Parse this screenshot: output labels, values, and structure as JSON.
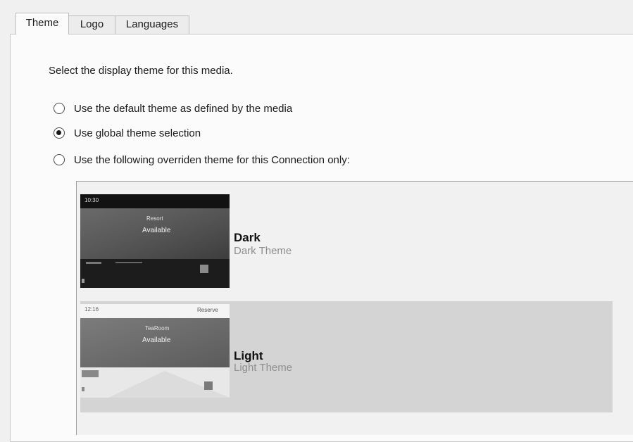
{
  "tabs": [
    {
      "label": "Theme",
      "active": true
    },
    {
      "label": "Logo",
      "active": false
    },
    {
      "label": "Languages",
      "active": false
    }
  ],
  "instruction": "Select the display theme for this media.",
  "options": [
    {
      "label": "Use the default theme as defined by the media",
      "checked": false
    },
    {
      "label": "Use global theme selection",
      "checked": true
    },
    {
      "label": "Use the following overriden theme for this Connection only:",
      "checked": false
    }
  ],
  "themes": [
    {
      "name": "Dark",
      "description": "Dark Theme",
      "selected": false,
      "thumbnail": {
        "time": "10:30",
        "room": "Resort",
        "status": "Available"
      }
    },
    {
      "name": "Light",
      "description": "Light Theme",
      "selected": true,
      "thumbnail": {
        "time": "12:16",
        "room": "TeaRoom",
        "status": "Available",
        "reserve": "Reserve"
      }
    }
  ],
  "colors": {
    "panel": "#fbfbfb",
    "window": "#f0f0f0",
    "selected_theme_bg": "#d4d4d4",
    "description_text": "#8f8f8f"
  }
}
